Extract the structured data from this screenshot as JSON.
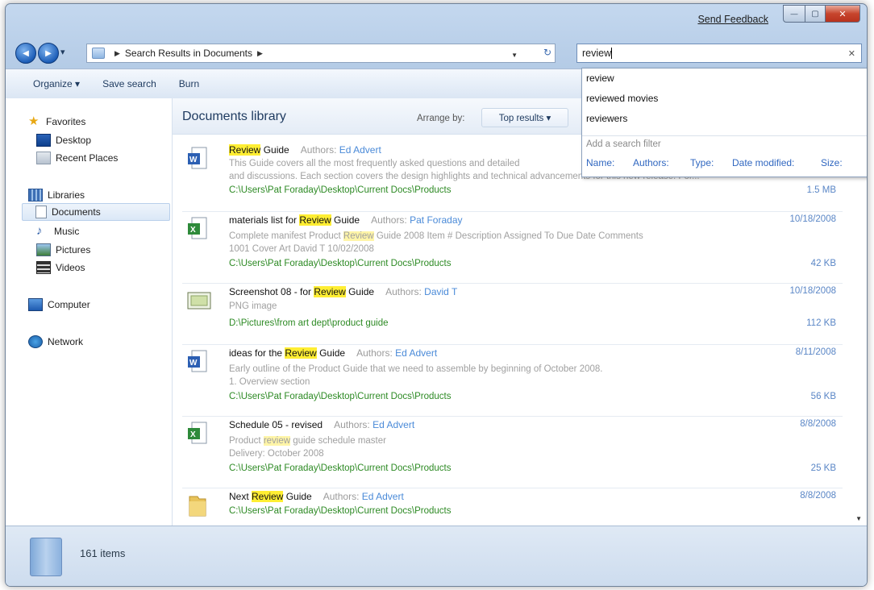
{
  "window": {
    "send_feedback": "Send Feedback",
    "caption": {
      "minimize": "—",
      "maximize": "▢",
      "close": "✕"
    }
  },
  "nav": {
    "back": "◀",
    "forward": "▶",
    "history": "▾",
    "breadcrumb": "Search Results in Documents",
    "refresh": "↻",
    "search_value": "review",
    "clear": "✕"
  },
  "toolbar": {
    "organize": "Organize ▾",
    "save_search": "Save search",
    "burn": "Burn"
  },
  "sidebar": {
    "favorites": "Favorites",
    "desktop": "Desktop",
    "recent_places": "Recent Places",
    "libraries": "Libraries",
    "documents": "Documents",
    "music": "Music",
    "pictures": "Pictures",
    "videos": "Videos",
    "computer": "Computer",
    "network": "Network"
  },
  "library": {
    "title": "Documents library",
    "arrange_label": "Arrange by:",
    "arrange_value": "Top results ▾"
  },
  "authors_label": "Authors:",
  "results": [
    {
      "pre": "",
      "hl": "Review",
      "post": " Guide",
      "author": "Ed Advert",
      "date": "",
      "desc1": "This Guide covers all the most frequently asked questions and detailed",
      "desc2": "and discussions. Each section covers the design highlights and technical advancements for this new release. For...",
      "path": "C:\\Users\\Pat Foraday\\Desktop\\Current Docs\\Products",
      "size": "1.5 MB"
    },
    {
      "pre": "materials list for ",
      "hl": "Review",
      "post": " Guide",
      "author": "Pat Foraday",
      "date": "10/18/2008",
      "desc1_pre": "Complete manifest  Product ",
      "desc1_hl": "Review",
      "desc1_post": " Guide 2008  Item #  Description  Assigned To  Due Date  Comments",
      "desc2": "1001  Cover Art  David T  10/02/2008",
      "path": "C:\\Users\\Pat Foraday\\Desktop\\Current Docs\\Products",
      "size": "42 KB"
    },
    {
      "pre": "Screenshot 08 - for ",
      "hl": "Review",
      "post": " Guide",
      "author": "David T",
      "date": "10/18/2008",
      "desc1": "PNG image",
      "path": "D:\\Pictures\\from art dept\\product guide",
      "size": "112 KB"
    },
    {
      "pre": "ideas for the ",
      "hl": "Review",
      "post": " Guide",
      "author": "Ed Advert",
      "date": "8/11/2008",
      "desc1": "Early outline of the Product Guide that we need to assemble by beginning of October 2008.",
      "desc2": "1. Overview section",
      "path": "C:\\Users\\Pat Foraday\\Desktop\\Current Docs\\Products",
      "size": "56 KB"
    },
    {
      "pre": "Schedule 05 - revised",
      "hl": "",
      "post": "",
      "author": "Ed Advert",
      "date": "8/8/2008",
      "desc1_pre": "Product ",
      "desc1_hl": "review",
      "desc1_post": " guide schedule master",
      "desc2": "Delivery: October 2008",
      "path": "C:\\Users\\Pat Foraday\\Desktop\\Current Docs\\Products",
      "size": "25 KB"
    },
    {
      "pre": "Next ",
      "hl": "Review",
      "post": " Guide",
      "author": "Ed Advert",
      "date": "8/8/2008",
      "path": "C:\\Users\\Pat Foraday\\Desktop\\Current Docs\\Products"
    }
  ],
  "status": {
    "items": "161 items"
  },
  "dropdown": {
    "suggestions": [
      "review",
      "reviewed movies",
      "reviewers"
    ],
    "filter_label": "Add a search filter",
    "filters": [
      "Name:",
      "Authors:",
      "Type:",
      "Date modified:",
      "Size:"
    ]
  },
  "colors": {
    "highlight": "#ffee33",
    "path_green": "#2d8a24",
    "link_blue": "#4a8ad8",
    "date_blue": "#5a86c6"
  }
}
